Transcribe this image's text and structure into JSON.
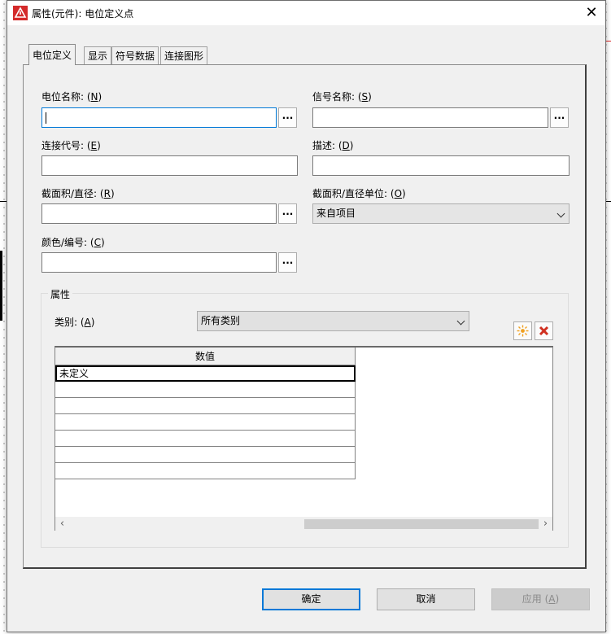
{
  "window": {
    "title": "属性(元件): 电位定义点",
    "close_glyph": "✕"
  },
  "tabs": [
    "电位定义",
    "显示",
    "符号数据",
    "连接图形"
  ],
  "fields": {
    "potential_name": {
      "label": "电位名称: ",
      "key": "N",
      "value": ""
    },
    "signal_name": {
      "label": "信号名称: ",
      "key": "S",
      "value": ""
    },
    "connection_code": {
      "label": "连接代号: ",
      "key": "E",
      "value": ""
    },
    "description": {
      "label": "描述: ",
      "key": "D",
      "value": ""
    },
    "cross_section": {
      "label": "截面积/直径: ",
      "key": "R",
      "value": ""
    },
    "cross_section_unit": {
      "label": "截面积/直径单位: ",
      "key": "O",
      "value": "来自项目"
    },
    "color_number": {
      "label": "颜色/编号: ",
      "key": "C",
      "value": ""
    },
    "dots_label": "..."
  },
  "properties_group": {
    "title": "属性",
    "category_label": "类别: ",
    "category_key": "A",
    "category_value": "所有类别",
    "grid": {
      "header": "数值",
      "rows": [
        "未定义",
        "",
        "",
        "",
        "",
        "",
        ""
      ]
    },
    "scroll_left": "‹",
    "scroll_right": "›"
  },
  "buttons": {
    "ok": "确定",
    "cancel": "取消",
    "apply": "应用 ",
    "apply_key": "A"
  },
  "colors": {
    "accent": "#0078d7",
    "new_icon": "#f0a020",
    "delete_icon": "#d03020",
    "app_icon": "#d42a2a"
  },
  "icons": {
    "new": "sun-new-icon",
    "delete": "red-x-delete-icon",
    "app": "eplan-logo-icon"
  }
}
